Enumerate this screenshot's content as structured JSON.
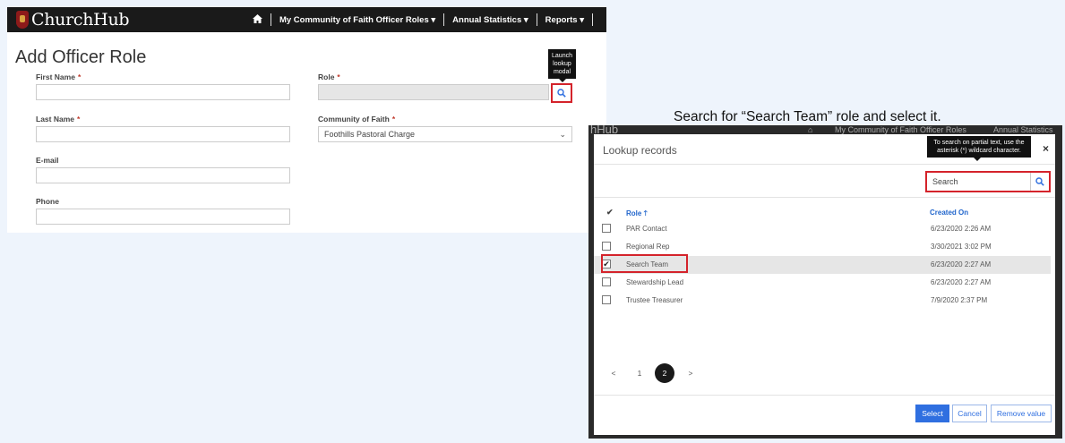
{
  "form": {
    "brand": "ChurchHub",
    "nav": [
      "My Community of Faith Officer Roles",
      "Annual Statistics",
      "Reports"
    ],
    "title": "Add Officer Role",
    "first_name_label": "First Name",
    "last_name_label": "Last Name",
    "email_label": "E-mail",
    "phone_label": "Phone",
    "role_label": "Role",
    "community_label": "Community of Faith",
    "community_value": "Foothills Pastoral Charge",
    "required_marker": "*",
    "lookup_tooltip": "Launch lookup modal",
    "accent": "#d4232b"
  },
  "caption": "Search for “Search Team” role and select it.",
  "modal": {
    "bg_nav": [
      "hHub",
      "My Community of Faith Officer Roles",
      "Annual Statistics"
    ],
    "title": "Lookup records",
    "close": "×",
    "search_placeholder": "Search",
    "search_tooltip": "To search on partial text, use the asterisk (*) wildcard character.",
    "col_role": "Role",
    "col_created": "Created On",
    "rows": [
      {
        "role": "PAR Contact",
        "created": "6/23/2020 2:26 AM",
        "checked": false
      },
      {
        "role": "Regional Rep",
        "created": "3/30/2021 3:02 PM",
        "checked": false
      },
      {
        "role": "Search Team",
        "created": "6/23/2020 2:27 AM",
        "checked": true
      },
      {
        "role": "Stewardship Lead",
        "created": "6/23/2020 2:27 AM",
        "checked": false
      },
      {
        "role": "Trustee Treasurer",
        "created": "7/9/2020 2:37 PM",
        "checked": false
      }
    ],
    "pager": {
      "prev": "<",
      "pages": [
        "1",
        "2"
      ],
      "current": "2",
      "next": ">"
    },
    "select_label": "Select",
    "cancel_label": "Cancel",
    "remove_label": "Remove value",
    "primary_color": "#2f6fe0"
  }
}
